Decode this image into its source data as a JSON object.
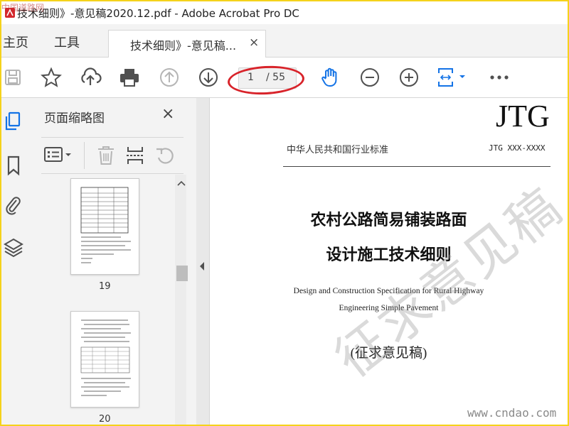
{
  "window": {
    "title": "技术细则》-意见稿2020.12.pdf - Adobe Acrobat Pro DC",
    "corner_logo": "中国道路网"
  },
  "tabs": {
    "home": "主页",
    "tools": "工具",
    "document": "技术细则》-意见稿...",
    "close_glyph": "×"
  },
  "toolbar": {
    "current_page": "1",
    "total_pages": "/ 55",
    "highlight_color": "#d8232a",
    "accent": "#1473e6"
  },
  "thumbnails_panel": {
    "title": "页面缩略图",
    "close_glyph": "×",
    "pages": [
      {
        "label": "19"
      },
      {
        "label": "20"
      }
    ]
  },
  "document": {
    "code": "JTG",
    "standard_line": "中华人民共和国行业标准",
    "standard_number": "JTG XXX-XXXX",
    "title_line1": "农村公路简易铺装路面",
    "title_line2": "设计施工技术细则",
    "english_line1": "Design and Construction Specification for Rural Highway",
    "english_line2": "Engineering Simple Pavement",
    "draft_label": "(征求意见稿)",
    "watermark": "征求意见稿"
  },
  "site_watermark": "www.cndao.com",
  "colors": {
    "frame_border": "#f5d21b",
    "panel_bg": "#f3f3f3",
    "icon_gray": "#505050",
    "disabled_gray": "#b5b5b5"
  }
}
